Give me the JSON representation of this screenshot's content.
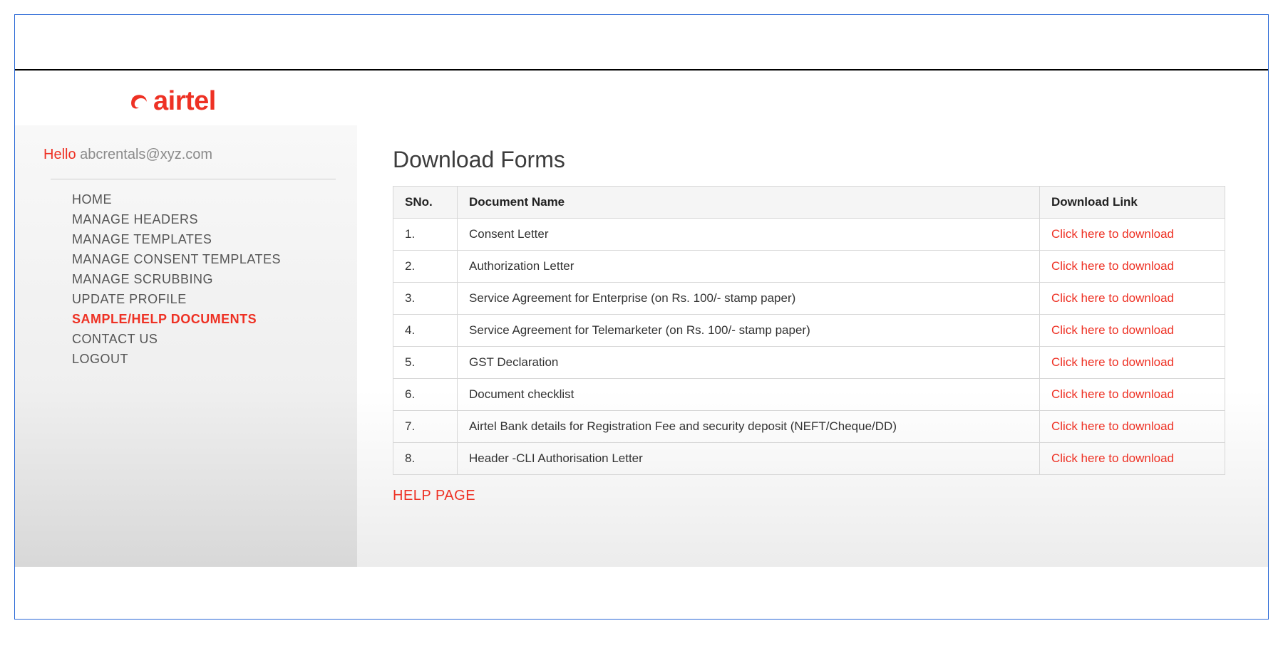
{
  "brand": {
    "logo_text": "airtel",
    "accent_color": "#ee3124"
  },
  "sidebar": {
    "greeting_prefix": "Hello",
    "user_email": "abcrentals@xyz.com",
    "items": [
      {
        "label": "HOME",
        "active": false
      },
      {
        "label": "MANAGE HEADERS",
        "active": false
      },
      {
        "label": "MANAGE TEMPLATES",
        "active": false
      },
      {
        "label": "MANAGE CONSENT TEMPLATES",
        "active": false
      },
      {
        "label": "MANAGE SCRUBBING",
        "active": false
      },
      {
        "label": "UPDATE PROFILE",
        "active": false
      },
      {
        "label": "SAMPLE/HELP DOCUMENTS",
        "active": true
      },
      {
        "label": "CONTACT US",
        "active": false
      },
      {
        "label": "LOGOUT",
        "active": false
      }
    ]
  },
  "main": {
    "title": "Download Forms",
    "columns": {
      "sno": "SNo.",
      "doc_name": "Document Name",
      "download": "Download Link"
    },
    "rows": [
      {
        "sno": "1.",
        "name": "Consent Letter",
        "link_label": "Click here to download"
      },
      {
        "sno": "2.",
        "name": "Authorization Letter",
        "link_label": "Click here to download"
      },
      {
        "sno": "3.",
        "name": "Service Agreement for Enterprise (on Rs. 100/- stamp paper)",
        "link_label": "Click here to download"
      },
      {
        "sno": "4.",
        "name": "Service Agreement for Telemarketer (on Rs. 100/- stamp paper)",
        "link_label": "Click here to download"
      },
      {
        "sno": "5.",
        "name": "GST Declaration",
        "link_label": "Click here to download"
      },
      {
        "sno": "6.",
        "name": "Document checklist",
        "link_label": "Click here to download"
      },
      {
        "sno": "7.",
        "name": "Airtel Bank details for Registration Fee and security deposit (NEFT/Cheque/DD)",
        "link_label": "Click here to download"
      },
      {
        "sno": "8.",
        "name": "Header -CLI Authorisation Letter",
        "link_label": "Click here to download"
      }
    ],
    "help_label": "HELP PAGE"
  }
}
